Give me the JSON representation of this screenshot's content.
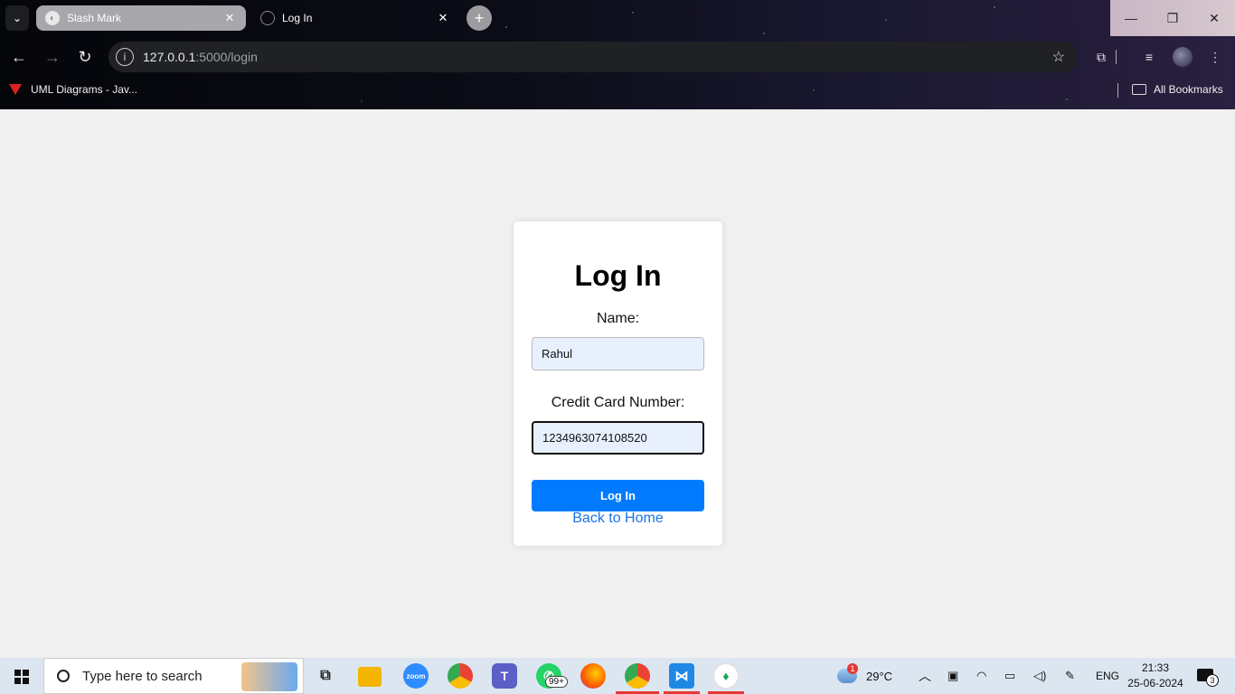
{
  "browser": {
    "tabs": [
      {
        "title": "Slash Mark",
        "active": true
      },
      {
        "title": "Log In",
        "active": false
      }
    ],
    "new_tab": "+",
    "close": "✕",
    "url_host": "127.0.0.1",
    "url_path": ":5000/login",
    "bookmarks": [
      {
        "label": "UML Diagrams - Jav..."
      }
    ],
    "all_bookmarks": "All Bookmarks"
  },
  "login": {
    "title": "Log In",
    "name_label": "Name:",
    "name_value": "Rahul",
    "card_label": "Credit Card Number:",
    "card_value": "1234963074108520",
    "submit_label": "Log In",
    "back_link": "Back to Home"
  },
  "taskbar": {
    "search_placeholder": "Type here to search",
    "zoom_label": "zoom",
    "whatsapp_badge": "99+",
    "weather": "29°C",
    "weather_badge": "1",
    "language": "ENG",
    "time": "21:33",
    "date": "25-06-2024",
    "notification_count": "3"
  },
  "colors": {
    "accent": "#007bff",
    "link": "#1a73e8",
    "input_bg": "#e8f0fe",
    "page_bg": "#f0f0f0"
  }
}
